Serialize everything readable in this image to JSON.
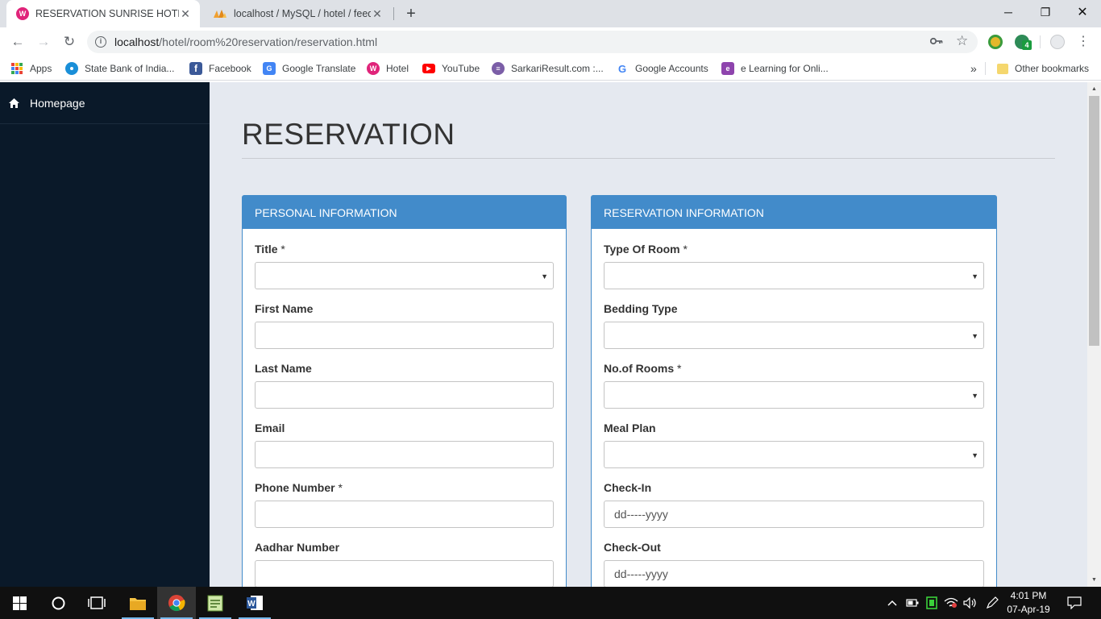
{
  "browser": {
    "tabs": [
      {
        "title": "RESERVATION SUNRISE HOTEL",
        "active": true,
        "icon": "hotel-favicon"
      },
      {
        "title": "localhost / MySQL / hotel / feedb",
        "active": false,
        "icon": "phpmyadmin-favicon"
      }
    ],
    "new_tab": "+",
    "window_controls": {
      "minimize": "─",
      "restore": "❐",
      "close": "✕"
    },
    "nav": {
      "back": "←",
      "forward": "→",
      "reload": "↻"
    },
    "url_host": "localhost",
    "url_path": "/hotel/room%20reservation/reservation.html",
    "key_icon": "key-icon",
    "star_icon": "star-icon",
    "extensions": {
      "badge_count": "4"
    },
    "menu": "⋮"
  },
  "bookmarks": {
    "items": [
      {
        "label": "Apps",
        "icon": "apps-grid-icon"
      },
      {
        "label": "State Bank of India...",
        "icon": "sbi-icon"
      },
      {
        "label": "Facebook",
        "icon": "facebook-icon"
      },
      {
        "label": "Google Translate",
        "icon": "google-translate-icon"
      },
      {
        "label": "Hotel",
        "icon": "hotel-icon"
      },
      {
        "label": "YouTube",
        "icon": "youtube-icon"
      },
      {
        "label": "SarkariResult.com :...",
        "icon": "sarkari-icon"
      },
      {
        "label": "Google Accounts",
        "icon": "google-icon"
      },
      {
        "label": "e Learning for Onli...",
        "icon": "elearning-icon"
      }
    ],
    "overflow": "»",
    "other": "Other bookmarks"
  },
  "sidebar": {
    "items": [
      {
        "label": "Homepage",
        "icon": "home-icon"
      }
    ]
  },
  "page": {
    "title": "RESERVATION",
    "personal": {
      "heading": "PERSONAL INFORMATION",
      "fields": [
        {
          "label": "Title",
          "required": "*",
          "type": "select",
          "value": ""
        },
        {
          "label": "First Name",
          "required": "",
          "type": "text",
          "value": ""
        },
        {
          "label": "Last Name",
          "required": "",
          "type": "text",
          "value": ""
        },
        {
          "label": "Email",
          "required": "",
          "type": "text",
          "value": ""
        },
        {
          "label": "Phone Number",
          "required": "*",
          "type": "text",
          "value": ""
        },
        {
          "label": "Aadhar Number",
          "required": "",
          "type": "text",
          "value": ""
        }
      ]
    },
    "reservation": {
      "heading": "RESERVATION INFORMATION",
      "fields": [
        {
          "label": "Type Of Room",
          "required": "*",
          "type": "select",
          "value": ""
        },
        {
          "label": "Bedding Type",
          "required": "",
          "type": "select",
          "value": ""
        },
        {
          "label": "No.of Rooms",
          "required": "*",
          "type": "select",
          "value": ""
        },
        {
          "label": "Meal Plan",
          "required": "",
          "type": "select",
          "value": ""
        },
        {
          "label": "Check-In",
          "required": "",
          "type": "date",
          "value": "dd-----yyyy"
        },
        {
          "label": "Check-Out",
          "required": "",
          "type": "date",
          "value": "dd-----yyyy"
        }
      ]
    }
  },
  "taskbar": {
    "time": "4:01 PM",
    "date": "07-Apr-19",
    "apps": [
      "start-icon",
      "cortana-icon",
      "task-view-icon",
      "file-explorer-icon",
      "chrome-icon",
      "notepad-icon",
      "word-icon"
    ]
  },
  "colors": {
    "sidebar": "#0a1929",
    "content_bg": "#e5e9f0",
    "panel_accent": "#428bca",
    "taskbar": "#101010"
  }
}
